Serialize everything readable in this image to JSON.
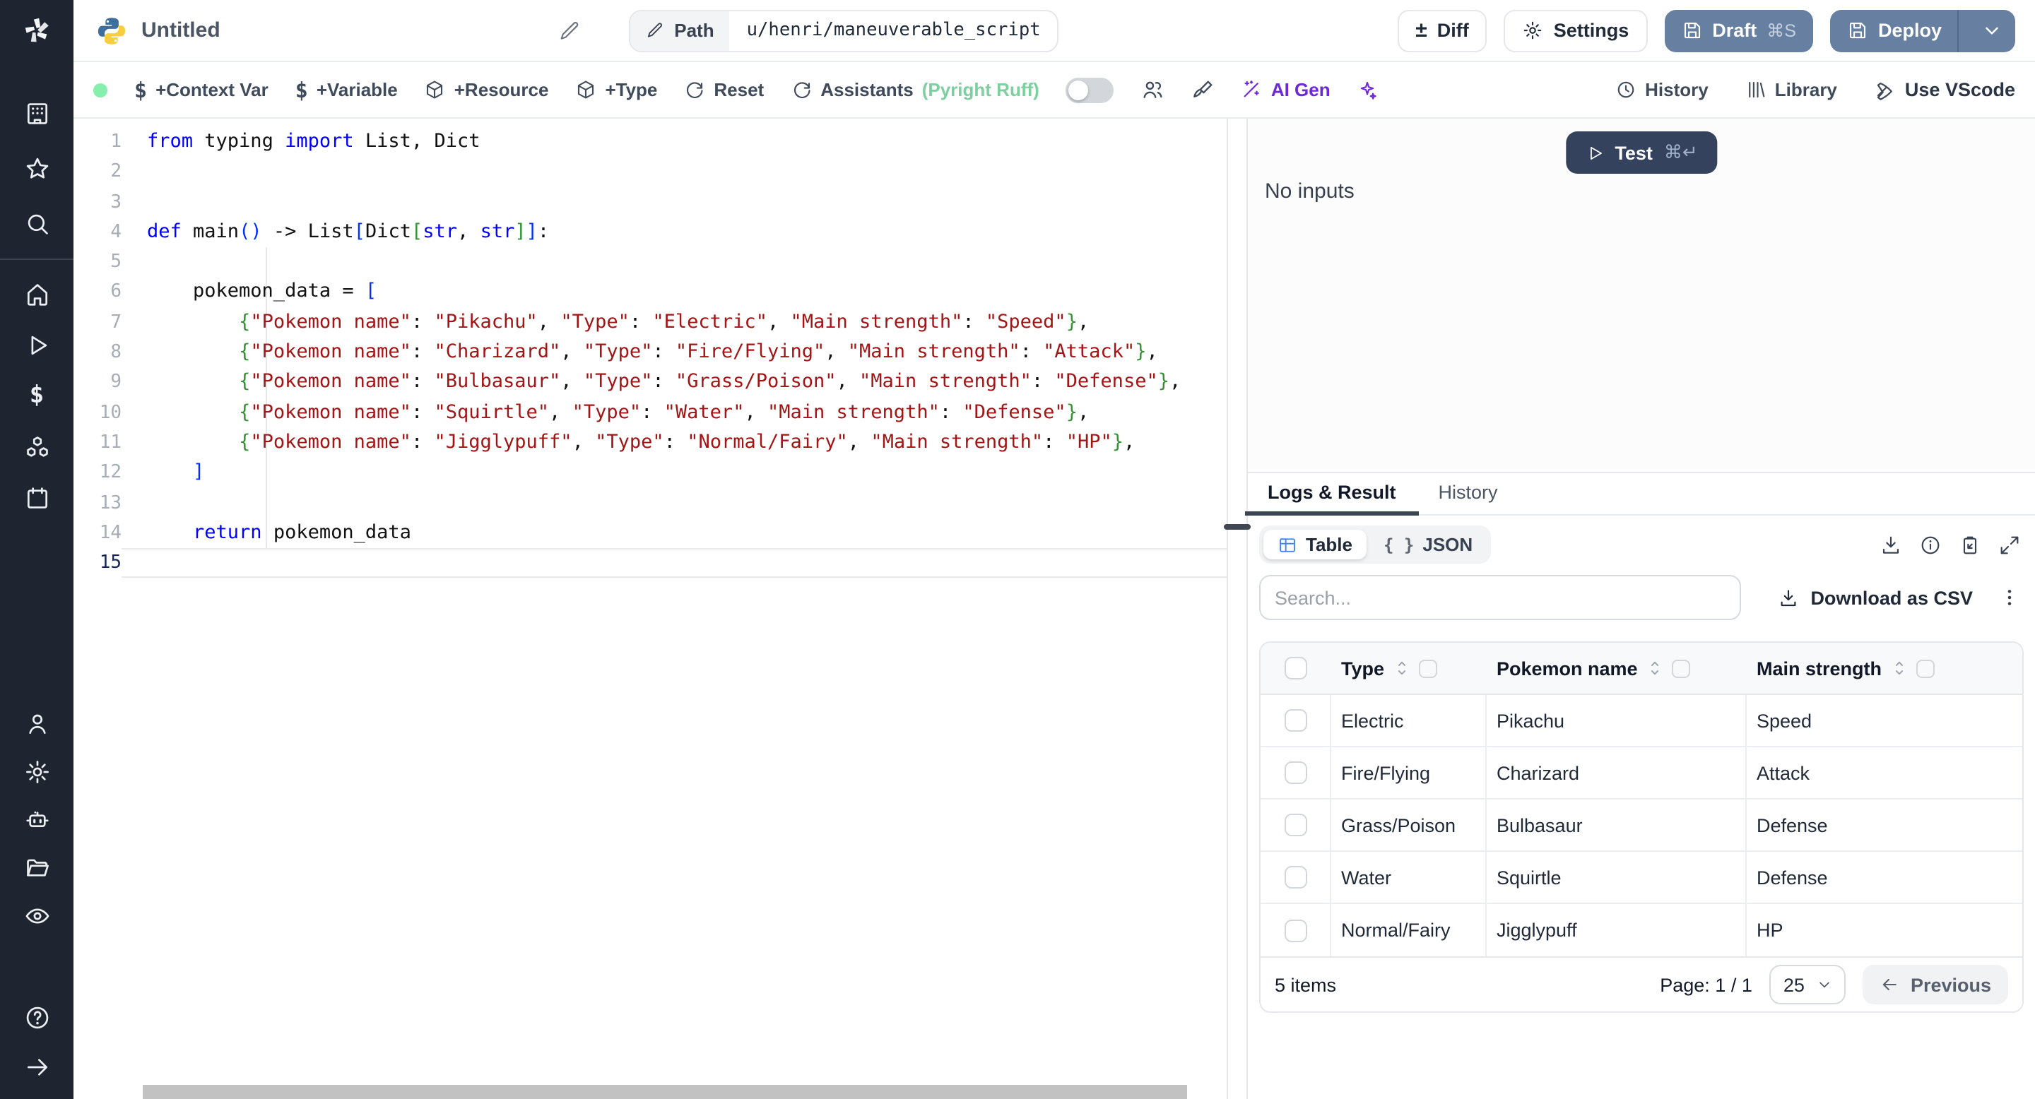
{
  "colors": {
    "sidebar_bg": "#1e2430",
    "primary_button": "#6780a2",
    "test_button": "#35425e",
    "accent_purple": "#6d28d9",
    "assistant_green": "#7ccf9f",
    "status_dot": "#86efac",
    "table_icon_blue": "#3b82f6",
    "code_keyword": "#0000ff",
    "code_string": "#a31515",
    "bracket_blue": "#0431fa",
    "bracket_green": "#319331"
  },
  "header": {
    "title": "Untitled",
    "path_label": "Path",
    "path_value": "u/henri/maneuverable_script",
    "diff_label": "Diff",
    "settings_label": "Settings",
    "draft_label": "Draft",
    "draft_kbd": "⌘S",
    "deploy_label": "Deploy"
  },
  "toolbar": {
    "context_var": "+Context Var",
    "variable": "+Variable",
    "resource": "+Resource",
    "type": "+Type",
    "reset": "Reset",
    "assistants": "Assistants",
    "assistants_note": "(Pyright Ruff)",
    "ai_gen": "AI Gen",
    "history": "History",
    "library": "Library",
    "vscode": "Use VScode"
  },
  "editor": {
    "lines": [
      {
        "num": 1,
        "tokens": [
          [
            "k",
            "from"
          ],
          [
            "p",
            " typing "
          ],
          [
            "k",
            "import"
          ],
          [
            "p",
            " List, Dict"
          ]
        ]
      },
      {
        "num": 2,
        "tokens": []
      },
      {
        "num": 3,
        "tokens": []
      },
      {
        "num": 4,
        "tokens": [
          [
            "k",
            "def"
          ],
          [
            "p",
            " main"
          ],
          [
            "bb",
            "()"
          ],
          [
            "p",
            " -> List"
          ],
          [
            "bb",
            "["
          ],
          [
            "p",
            "Dict"
          ],
          [
            "bg",
            "["
          ],
          [
            "k",
            "str"
          ],
          [
            "p",
            ", "
          ],
          [
            "k",
            "str"
          ],
          [
            "bg",
            "]"
          ],
          [
            "bb",
            "]"
          ],
          [
            "p",
            ":"
          ]
        ]
      },
      {
        "num": 5,
        "tokens": []
      },
      {
        "num": 6,
        "tokens": [
          [
            "p",
            "    pokemon_data = "
          ],
          [
            "bb",
            "["
          ]
        ]
      },
      {
        "num": 7,
        "tokens": [
          [
            "p",
            "        "
          ],
          [
            "bg",
            "{"
          ],
          [
            "s",
            "\"Pokemon name\""
          ],
          [
            "p",
            ": "
          ],
          [
            "s",
            "\"Pikachu\""
          ],
          [
            "p",
            ", "
          ],
          [
            "s",
            "\"Type\""
          ],
          [
            "p",
            ": "
          ],
          [
            "s",
            "\"Electric\""
          ],
          [
            "p",
            ", "
          ],
          [
            "s",
            "\"Main strength\""
          ],
          [
            "p",
            ": "
          ],
          [
            "s",
            "\"Speed\""
          ],
          [
            "bg",
            "}"
          ],
          [
            "p",
            ","
          ]
        ]
      },
      {
        "num": 8,
        "tokens": [
          [
            "p",
            "        "
          ],
          [
            "bg",
            "{"
          ],
          [
            "s",
            "\"Pokemon name\""
          ],
          [
            "p",
            ": "
          ],
          [
            "s",
            "\"Charizard\""
          ],
          [
            "p",
            ", "
          ],
          [
            "s",
            "\"Type\""
          ],
          [
            "p",
            ": "
          ],
          [
            "s",
            "\"Fire/Flying\""
          ],
          [
            "p",
            ", "
          ],
          [
            "s",
            "\"Main strength\""
          ],
          [
            "p",
            ": "
          ],
          [
            "s",
            "\"Attack\""
          ],
          [
            "bg",
            "}"
          ],
          [
            "p",
            ","
          ]
        ]
      },
      {
        "num": 9,
        "tokens": [
          [
            "p",
            "        "
          ],
          [
            "bg",
            "{"
          ],
          [
            "s",
            "\"Pokemon name\""
          ],
          [
            "p",
            ": "
          ],
          [
            "s",
            "\"Bulbasaur\""
          ],
          [
            "p",
            ", "
          ],
          [
            "s",
            "\"Type\""
          ],
          [
            "p",
            ": "
          ],
          [
            "s",
            "\"Grass/Poison\""
          ],
          [
            "p",
            ", "
          ],
          [
            "s",
            "\"Main strength\""
          ],
          [
            "p",
            ": "
          ],
          [
            "s",
            "\"Defense\""
          ],
          [
            "bg",
            "}"
          ],
          [
            "p",
            ","
          ]
        ]
      },
      {
        "num": 10,
        "tokens": [
          [
            "p",
            "        "
          ],
          [
            "bg",
            "{"
          ],
          [
            "s",
            "\"Pokemon name\""
          ],
          [
            "p",
            ": "
          ],
          [
            "s",
            "\"Squirtle\""
          ],
          [
            "p",
            ", "
          ],
          [
            "s",
            "\"Type\""
          ],
          [
            "p",
            ": "
          ],
          [
            "s",
            "\"Water\""
          ],
          [
            "p",
            ", "
          ],
          [
            "s",
            "\"Main strength\""
          ],
          [
            "p",
            ": "
          ],
          [
            "s",
            "\"Defense\""
          ],
          [
            "bg",
            "}"
          ],
          [
            "p",
            ","
          ]
        ]
      },
      {
        "num": 11,
        "tokens": [
          [
            "p",
            "        "
          ],
          [
            "bg",
            "{"
          ],
          [
            "s",
            "\"Pokemon name\""
          ],
          [
            "p",
            ": "
          ],
          [
            "s",
            "\"Jigglypuff\""
          ],
          [
            "p",
            ", "
          ],
          [
            "s",
            "\"Type\""
          ],
          [
            "p",
            ": "
          ],
          [
            "s",
            "\"Normal/Fairy\""
          ],
          [
            "p",
            ", "
          ],
          [
            "s",
            "\"Main strength\""
          ],
          [
            "p",
            ": "
          ],
          [
            "s",
            "\"HP\""
          ],
          [
            "bg",
            "}"
          ],
          [
            "p",
            ","
          ]
        ]
      },
      {
        "num": 12,
        "tokens": [
          [
            "p",
            "    "
          ],
          [
            "bb",
            "]"
          ]
        ]
      },
      {
        "num": 13,
        "tokens": []
      },
      {
        "num": 14,
        "tokens": [
          [
            "p",
            "    "
          ],
          [
            "k",
            "return"
          ],
          [
            "p",
            " pokemon_data"
          ]
        ]
      },
      {
        "num": 15,
        "tokens": [],
        "active": true
      }
    ]
  },
  "run": {
    "test_label": "Test",
    "test_kbd": "⌘↵",
    "no_inputs": "No inputs"
  },
  "result": {
    "tabs": [
      "Logs & Result",
      "History"
    ],
    "view_table": "Table",
    "view_json": "JSON",
    "json_glyph": "{ }",
    "search_placeholder": "Search...",
    "download_csv": "Download as CSV",
    "table": {
      "columns": [
        "Type",
        "Pokemon name",
        "Main strength"
      ],
      "rows": [
        [
          "Electric",
          "Pikachu",
          "Speed"
        ],
        [
          "Fire/Flying",
          "Charizard",
          "Attack"
        ],
        [
          "Grass/Poison",
          "Bulbasaur",
          "Defense"
        ],
        [
          "Water",
          "Squirtle",
          "Defense"
        ],
        [
          "Normal/Fairy",
          "Jigglypuff",
          "HP"
        ]
      ],
      "items_label": "5 items",
      "page_label": "Page: 1 / 1",
      "page_size": "25",
      "previous_label": "Previous"
    }
  },
  "sidebar": {
    "icons": [
      "workspace",
      "favorites",
      "search",
      "home",
      "runs",
      "variables",
      "resources",
      "schedules",
      "users",
      "settings",
      "workers",
      "folders",
      "audit-logs",
      "help",
      "expand"
    ]
  }
}
